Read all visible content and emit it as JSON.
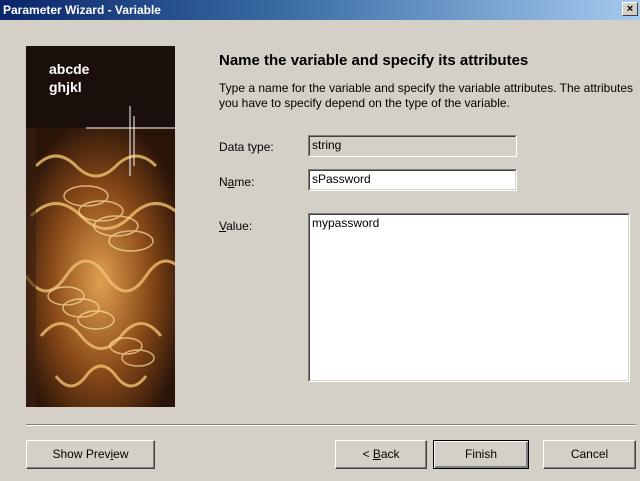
{
  "window": {
    "title": "Parameter Wizard - Variable",
    "close_label": "×"
  },
  "banner": {
    "text": "abcde\nghjkl"
  },
  "main": {
    "heading": "Name the variable and specify its attributes",
    "description": "Type a name for the variable and specify the variable attributes. The attributes you have to specify depend on the type of the variable."
  },
  "fields": {
    "data_type": {
      "label": "Data type:",
      "value": "string"
    },
    "name": {
      "label_pre": "N",
      "label_mnemonic": "a",
      "label_post": "me:",
      "value": "sPassword"
    },
    "value": {
      "label_pre": "",
      "label_mnemonic": "V",
      "label_post": "alue:",
      "value": "mypassword"
    }
  },
  "buttons": {
    "show_preview": {
      "pre": "Show Prev",
      "mnemonic": "i",
      "post": "ew"
    },
    "back": {
      "pre": "< ",
      "mnemonic": "B",
      "post": "ack"
    },
    "finish": "Finish",
    "cancel": "Cancel"
  }
}
